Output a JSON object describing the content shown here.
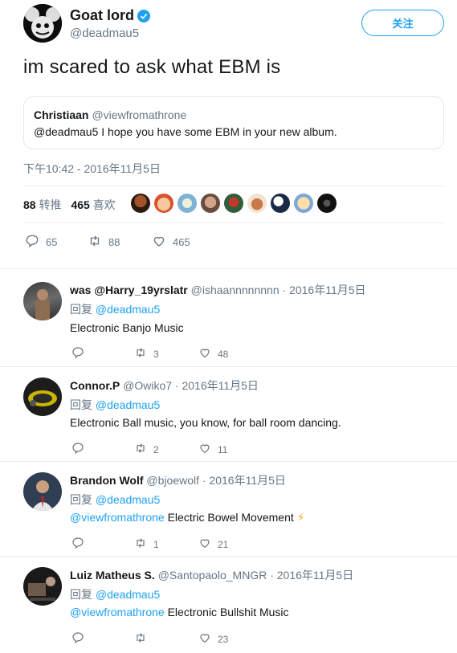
{
  "tweet": {
    "author_name": "Goat lord",
    "author_handle": "@deadmau5",
    "follow_label": "关注",
    "text": "im scared to ask what EBM is",
    "quote": {
      "name": "Christiaan",
      "handle": "@viewfromathrone",
      "text": "@deadmau5 I hope you have some EBM in your new album."
    },
    "timestamp": "下午10:42 - 2016年11月5日",
    "retweets_count": "88",
    "retweets_label": "转推",
    "likes_count": "465",
    "likes_label": "喜欢",
    "actions": {
      "replies": "65",
      "retweets": "88",
      "likes": "465"
    }
  },
  "colors": {
    "accent": "#1da1f2",
    "muted": "#657786",
    "text": "#14171a",
    "divider": "#e6ecf0"
  },
  "replies": [
    {
      "name": "was @Harry_19yrslatr",
      "handle": "@ishaannnnnnnn",
      "date": "· 2016年11月5日",
      "reply_to_label": "回复",
      "reply_to": "@deadmau5",
      "mention": "",
      "text": "Electronic Banjo Music",
      "retweets": "3",
      "likes": "48"
    },
    {
      "name": "Connor.P",
      "handle": "@Owiko7",
      "date": "· 2016年11月5日",
      "reply_to_label": "回复",
      "reply_to": "@deadmau5",
      "mention": "",
      "text": "Electronic Ball music, you know, for ball room dancing.",
      "retweets": "2",
      "likes": "11"
    },
    {
      "name": "Brandon Wolf",
      "handle": "@bjoewolf",
      "date": "· 2016年11月5日",
      "reply_to_label": "回复",
      "reply_to": "@deadmau5",
      "mention": "@viewfromathrone",
      "text": " Electric Bowel Movement",
      "emoji": "⚡",
      "retweets": "1",
      "likes": "21"
    },
    {
      "name": "Luiz Matheus S.",
      "handle": "@Santopaolo_MNGR",
      "date": "· 2016年11月5日",
      "reply_to_label": "回复",
      "reply_to": "@deadmau5",
      "mention": "@viewfromathrone",
      "text": " Electronic Bullshit Music",
      "retweets": "",
      "likes": "23"
    }
  ]
}
